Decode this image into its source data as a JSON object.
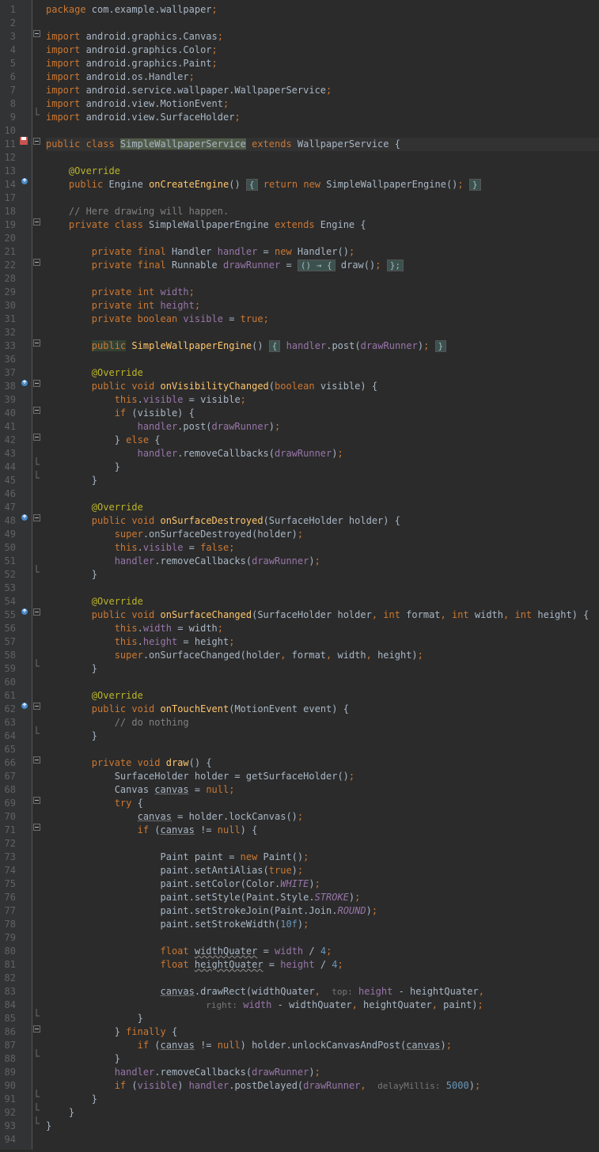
{
  "lines": [
    {
      "n": 1,
      "html": "<span class='kw'>package</span> com.example.wallpaper<span class='kw'>;</span>"
    },
    {
      "n": 2,
      "html": ""
    },
    {
      "n": 3,
      "fold": "minus",
      "html": "<span class='kw'>import</span> android.graphics.Canvas<span class='kw'>;</span>"
    },
    {
      "n": 4,
      "html": "<span class='kw'>import</span> android.graphics.Color<span class='kw'>;</span>"
    },
    {
      "n": 5,
      "html": "<span class='kw'>import</span> android.graphics.Paint<span class='kw'>;</span>"
    },
    {
      "n": 6,
      "html": "<span class='kw'>import</span> android.os.Handler<span class='kw'>;</span>"
    },
    {
      "n": 7,
      "html": "<span class='kw'>import</span> android.service.wallpaper.WallpaperService<span class='kw'>;</span>"
    },
    {
      "n": 8,
      "html": "<span class='kw'>import</span> android.view.MotionEvent<span class='kw'>;</span>"
    },
    {
      "n": 9,
      "fold": "end",
      "html": "<span class='kw'>import</span> android.view.SurfaceHolder<span class='kw'>;</span>"
    },
    {
      "n": 10,
      "html": ""
    },
    {
      "n": 11,
      "ann": "save",
      "fold": "minus",
      "hl": true,
      "html": "<span class='kw'>public class </span><span class='classname-hl'>SimpleWallpaperService</span> <span class='kw'>extends</span> WallpaperService {"
    },
    {
      "n": 12,
      "html": ""
    },
    {
      "n": 13,
      "html": "    <span class='anno'>@Override</span>"
    },
    {
      "n": 14,
      "ann": "override",
      "html": "    <span class='kw'>public</span> Engine <span class='meth'>onCreateEngine</span>() <span class='fold-box'>{</span> <span class='kw'>return new</span> SimpleWallpaperEngine()<span class='kw'>;</span> <span class='fold-box'>}</span>"
    },
    {
      "n": 17,
      "html": ""
    },
    {
      "n": 18,
      "html": "    <span class='com'>// Here drawing will happen.</span>"
    },
    {
      "n": 19,
      "fold": "minus",
      "html": "    <span class='kw'>private class</span> SimpleWallpaperEngine <span class='kw'>extends</span> Engine {"
    },
    {
      "n": 20,
      "html": ""
    },
    {
      "n": 21,
      "html": "        <span class='kw'>private final</span> Handler <span class='field'>handler</span> = <span class='kw'>new</span> Handler()<span class='kw'>;</span>"
    },
    {
      "n": 22,
      "fold": "minus",
      "html": "        <span class='kw'>private final</span> Runnable <span class='field'>drawRunner</span> = <span class='fold-box'>() → {</span> draw()<span class='kw'>;</span> <span class='fold-box'>};</span>"
    },
    {
      "n": 28,
      "html": ""
    },
    {
      "n": 29,
      "html": "        <span class='kw'>private int</span> <span class='field'>width</span><span class='kw'>;</span>"
    },
    {
      "n": 30,
      "html": "        <span class='kw'>private int</span> <span class='field'>height</span><span class='kw'>;</span>"
    },
    {
      "n": 31,
      "html": "        <span class='kw'>private boolean</span> <span class='field'>visible</span> = <span class='kw'>true;</span>"
    },
    {
      "n": 32,
      "html": ""
    },
    {
      "n": 33,
      "fold": "minus",
      "html": "        <span class='keyword-hl kw'>public</span> <span class='meth'>SimpleWallpaperEngine</span>() <span class='fold-box'>{</span> <span class='field'>handler</span>.post(<span class='field'>drawRunner</span>)<span class='kw'>;</span> <span class='fold-box'>}</span>"
    },
    {
      "n": 36,
      "html": ""
    },
    {
      "n": 37,
      "html": "        <span class='anno'>@Override</span>"
    },
    {
      "n": 38,
      "ann": "override",
      "fold": "minus",
      "html": "        <span class='kw'>public void</span> <span class='meth'>onVisibilityChanged</span>(<span class='kw'>boolean</span> visible) {"
    },
    {
      "n": 39,
      "html": "            <span class='kw'>this</span>.<span class='field'>visible</span> = visible<span class='kw'>;</span>"
    },
    {
      "n": 40,
      "fold": "minus",
      "html": "            <span class='kw'>if</span> (visible) {"
    },
    {
      "n": 41,
      "html": "                <span class='field'>handler</span>.post(<span class='field'>drawRunner</span>)<span class='kw'>;</span>"
    },
    {
      "n": 42,
      "fold": "minus",
      "html": "            } <span class='kw'>else</span> {"
    },
    {
      "n": 43,
      "html": "                <span class='field'>handler</span>.removeCallbacks(<span class='field'>drawRunner</span>)<span class='kw'>;</span>"
    },
    {
      "n": 44,
      "fold": "end",
      "html": "            }"
    },
    {
      "n": 45,
      "fold": "end",
      "html": "        }"
    },
    {
      "n": 46,
      "html": ""
    },
    {
      "n": 47,
      "html": "        <span class='anno'>@Override</span>"
    },
    {
      "n": 48,
      "ann": "override",
      "fold": "minus",
      "html": "        <span class='kw'>public void</span> <span class='meth'>onSurfaceDestroyed</span>(SurfaceHolder holder) {"
    },
    {
      "n": 49,
      "html": "            <span class='kw'>super</span>.onSurfaceDestroyed(holder)<span class='kw'>;</span>"
    },
    {
      "n": 50,
      "html": "            <span class='kw'>this</span>.<span class='field'>visible</span> = <span class='kw'>false;</span>"
    },
    {
      "n": 51,
      "html": "            <span class='field'>handler</span>.removeCallbacks(<span class='field'>drawRunner</span>)<span class='kw'>;</span>"
    },
    {
      "n": 52,
      "fold": "end",
      "html": "        }"
    },
    {
      "n": 53,
      "html": ""
    },
    {
      "n": 54,
      "html": "        <span class='anno'>@Override</span>"
    },
    {
      "n": 55,
      "ann": "override",
      "fold": "minus",
      "html": "        <span class='kw'>public void</span> <span class='meth'>onSurfaceChanged</span>(SurfaceHolder holder<span class='kw'>, int</span> format<span class='kw'>, int</span> width<span class='kw'>, int</span> height) {"
    },
    {
      "n": 56,
      "html": "            <span class='kw'>this</span>.<span class='field'>width</span> = width<span class='kw'>;</span>"
    },
    {
      "n": 57,
      "html": "            <span class='kw'>this</span>.<span class='field'>height</span> = height<span class='kw'>;</span>"
    },
    {
      "n": 58,
      "html": "            <span class='kw'>super</span>.onSurfaceChanged(holder<span class='kw'>,</span> format<span class='kw'>,</span> width<span class='kw'>,</span> height)<span class='kw'>;</span>"
    },
    {
      "n": 59,
      "fold": "end",
      "html": "        }"
    },
    {
      "n": 60,
      "html": ""
    },
    {
      "n": 61,
      "html": "        <span class='anno'>@Override</span>"
    },
    {
      "n": 62,
      "ann": "override",
      "fold": "minus",
      "html": "        <span class='kw'>public void</span> <span class='meth'>onTouchEvent</span>(MotionEvent event) {"
    },
    {
      "n": 63,
      "html": "            <span class='com'>// do nothing</span>"
    },
    {
      "n": 64,
      "fold": "end",
      "html": "        }"
    },
    {
      "n": 65,
      "html": ""
    },
    {
      "n": 66,
      "fold": "minus",
      "html": "        <span class='kw'>private void</span> <span class='meth'>draw</span>() {"
    },
    {
      "n": 67,
      "html": "            SurfaceHolder holder = getSurfaceHolder()<span class='kw'>;</span>"
    },
    {
      "n": 68,
      "html": "            Canvas <span class='underline'>canvas</span> = <span class='kw'>null;</span>"
    },
    {
      "n": 69,
      "fold": "minus",
      "html": "            <span class='kw'>try</span> {"
    },
    {
      "n": 70,
      "html": "                <span class='underline'>canvas</span> = holder.lockCanvas()<span class='kw'>;</span>"
    },
    {
      "n": 71,
      "fold": "minus",
      "html": "                <span class='kw'>if</span> (<span class='underline'>canvas</span> != <span class='kw'>null</span>) {"
    },
    {
      "n": 72,
      "html": ""
    },
    {
      "n": 73,
      "html": "                    Paint paint = <span class='kw'>new</span> Paint()<span class='kw'>;</span>"
    },
    {
      "n": 74,
      "html": "                    paint.setAntiAlias(<span class='kw'>true</span>)<span class='kw'>;</span>"
    },
    {
      "n": 75,
      "html": "                    paint.setColor(Color.<span class='italic'>WHITE</span>)<span class='kw'>;</span>"
    },
    {
      "n": 76,
      "html": "                    paint.setStyle(Paint.Style.<span class='italic'>STROKE</span>)<span class='kw'>;</span>"
    },
    {
      "n": 77,
      "html": "                    paint.setStrokeJoin(Paint.Join.<span class='italic'>ROUND</span>)<span class='kw'>;</span>"
    },
    {
      "n": 78,
      "html": "                    paint.setStrokeWidth(<span class='num'>10f</span>)<span class='kw'>;</span>"
    },
    {
      "n": 79,
      "html": ""
    },
    {
      "n": 80,
      "html": "                    <span class='kw'>float</span> <span class='wavy'>widthQuater</span> = <span class='field'>width</span> / <span class='num'>4</span><span class='kw'>;</span>"
    },
    {
      "n": 81,
      "html": "                    <span class='kw'>float</span> <span class='wavy'>heightQuater</span> = <span class='field'>height</span> / <span class='num'>4</span><span class='kw'>;</span>"
    },
    {
      "n": 82,
      "html": ""
    },
    {
      "n": 83,
      "html": "                    <span class='underline'>canvas</span>.drawRect(widthQuater<span class='kw'>,</span>  <span class='hint'>top:</span> <span class='field'>height</span> - heightQuater<span class='kw'>,</span>"
    },
    {
      "n": 84,
      "html": "                            <span class='hint'>right:</span> <span class='field'>width</span> - widthQuater<span class='kw'>,</span> heightQuater<span class='kw'>,</span> paint)<span class='kw'>;</span>"
    },
    {
      "n": 85,
      "fold": "end",
      "html": "                }"
    },
    {
      "n": 86,
      "fold": "minus",
      "html": "            } <span class='kw'>finally</span> {"
    },
    {
      "n": 87,
      "html": "                <span class='kw'>if</span> (<span class='underline'>canvas</span> != <span class='kw'>null</span>) holder.unlockCanvasAndPost(<span class='underline'>canvas</span>)<span class='kw'>;</span>"
    },
    {
      "n": 88,
      "fold": "end",
      "html": "            }"
    },
    {
      "n": 89,
      "html": "            <span class='field'>handler</span>.removeCallbacks(<span class='field'>drawRunner</span>)<span class='kw'>;</span>"
    },
    {
      "n": 90,
      "html": "            <span class='kw'>if</span> (<span class='field'>visible</span>) <span class='field'>handler</span>.postDelayed(<span class='field'>drawRunner</span><span class='kw'>,</span>  <span class='hint'>delayMillis:</span> <span class='num'>5000</span>)<span class='kw'>;</span>"
    },
    {
      "n": 91,
      "fold": "end",
      "html": "        }"
    },
    {
      "n": 92,
      "fold": "end",
      "html": "    }"
    },
    {
      "n": 93,
      "fold": "end",
      "html": "}"
    },
    {
      "n": 94,
      "html": ""
    }
  ]
}
